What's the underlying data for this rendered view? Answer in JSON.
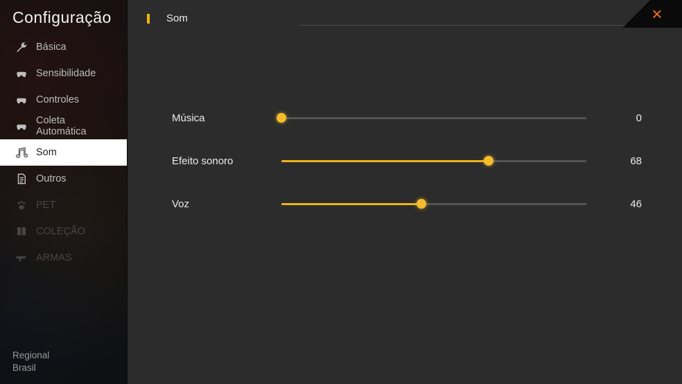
{
  "colors": {
    "accent": "#f0b41b",
    "close": "#ff6a1f"
  },
  "header": {
    "title": "Configuração"
  },
  "close": {
    "label": "×"
  },
  "sidebar": {
    "items": [
      {
        "label": "Básica",
        "icon": "wrench",
        "dim": false,
        "active": false
      },
      {
        "label": "Sensibilidade",
        "icon": "controller",
        "dim": false,
        "active": false
      },
      {
        "label": "Controles",
        "icon": "controller",
        "dim": false,
        "active": false
      },
      {
        "label": "Coleta Automática",
        "icon": "controller",
        "dim": false,
        "active": false
      },
      {
        "label": "Som",
        "icon": "music",
        "dim": false,
        "active": true
      },
      {
        "label": "Outros",
        "icon": "paper",
        "dim": false,
        "active": false
      },
      {
        "label": "PET",
        "icon": "paw",
        "dim": true,
        "active": false
      },
      {
        "label": "COLEÇÃO",
        "icon": "book",
        "dim": true,
        "active": false
      },
      {
        "label": "ARMAS",
        "icon": "gun",
        "dim": true,
        "active": false
      }
    ],
    "footer": {
      "line1": "Regional",
      "line2": "Brasil"
    }
  },
  "panel": {
    "title": "Som",
    "sliders": [
      {
        "label": "Música",
        "value": 0
      },
      {
        "label": "Efeito sonoro",
        "value": 68
      },
      {
        "label": "Voz",
        "value": 46
      }
    ]
  }
}
